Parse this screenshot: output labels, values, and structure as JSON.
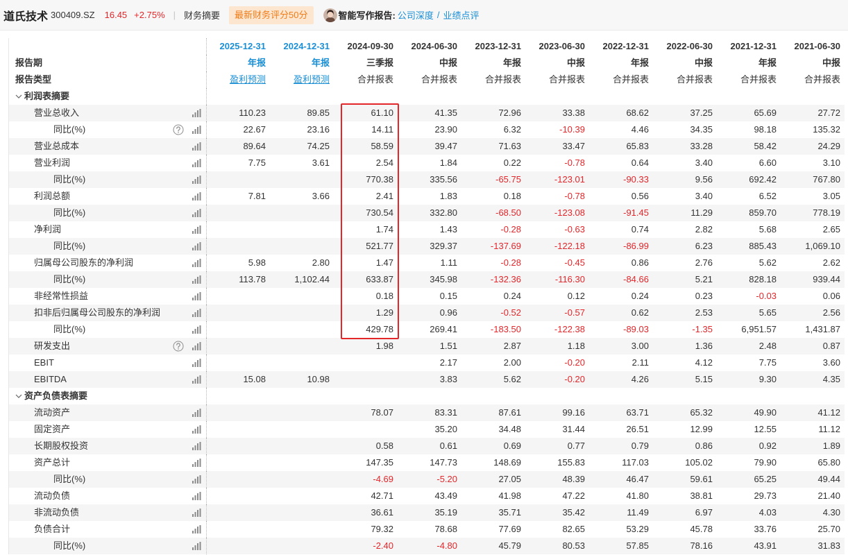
{
  "header": {
    "company": "道氏技术",
    "code": "300409.SZ",
    "price": "16.45",
    "change": "+2.75%",
    "divider": "|",
    "tab": "财务摘要",
    "score_badge": "最新财务评分50分",
    "report_label": "智能写作报告:",
    "report_links": [
      "公司深度",
      "业绩点评"
    ],
    "link_separator": "/"
  },
  "header_labels": {
    "period": "报告期",
    "type": "报告类型"
  },
  "columns": [
    {
      "date": "2025-12-31",
      "period": "年报",
      "type": "盈利预测",
      "forecast": true
    },
    {
      "date": "2024-12-31",
      "period": "年报",
      "type": "盈利预测",
      "forecast": true
    },
    {
      "date": "2024-09-30",
      "period": "三季报",
      "type": "合并报表",
      "forecast": false
    },
    {
      "date": "2024-06-30",
      "period": "中报",
      "type": "合并报表",
      "forecast": false
    },
    {
      "date": "2023-12-31",
      "period": "年报",
      "type": "合并报表",
      "forecast": false
    },
    {
      "date": "2023-06-30",
      "period": "中报",
      "type": "合并报表",
      "forecast": false
    },
    {
      "date": "2022-12-31",
      "period": "年报",
      "type": "合并报表",
      "forecast": false
    },
    {
      "date": "2022-06-30",
      "period": "中报",
      "type": "合并报表",
      "forecast": false
    },
    {
      "date": "2021-12-31",
      "period": "年报",
      "type": "合并报表",
      "forecast": false
    },
    {
      "date": "2021-06-30",
      "period": "中报",
      "type": "合并报表",
      "forecast": false
    }
  ],
  "sections": [
    {
      "title": "利润表摘要",
      "rows": [
        {
          "label": "营业总收入",
          "sub": false,
          "help": false,
          "values": [
            "110.23",
            "89.85",
            "61.10",
            "41.35",
            "72.96",
            "33.38",
            "68.62",
            "37.25",
            "65.69",
            "27.72"
          ]
        },
        {
          "label": "同比(%)",
          "sub": true,
          "help": true,
          "values": [
            "22.67",
            "23.16",
            "14.11",
            "23.90",
            "6.32",
            "-10.39",
            "4.46",
            "34.35",
            "98.18",
            "135.32"
          ]
        },
        {
          "label": "营业总成本",
          "sub": false,
          "help": false,
          "values": [
            "89.64",
            "74.25",
            "58.59",
            "39.47",
            "71.63",
            "33.47",
            "65.83",
            "33.28",
            "58.42",
            "24.29"
          ]
        },
        {
          "label": "营业利润",
          "sub": false,
          "help": false,
          "values": [
            "7.75",
            "3.61",
            "2.54",
            "1.84",
            "0.22",
            "-0.78",
            "0.64",
            "3.40",
            "6.60",
            "3.10"
          ]
        },
        {
          "label": "同比(%)",
          "sub": true,
          "help": false,
          "values": [
            "",
            "",
            "770.38",
            "335.56",
            "-65.75",
            "-123.01",
            "-90.33",
            "9.56",
            "692.42",
            "767.80"
          ]
        },
        {
          "label": "利润总额",
          "sub": false,
          "help": false,
          "values": [
            "7.81",
            "3.66",
            "2.41",
            "1.83",
            "0.18",
            "-0.78",
            "0.56",
            "3.40",
            "6.52",
            "3.05"
          ]
        },
        {
          "label": "同比(%)",
          "sub": true,
          "help": false,
          "values": [
            "",
            "",
            "730.54",
            "332.80",
            "-68.50",
            "-123.08",
            "-91.45",
            "11.29",
            "859.70",
            "778.19"
          ]
        },
        {
          "label": "净利润",
          "sub": false,
          "help": false,
          "values": [
            "",
            "",
            "1.74",
            "1.43",
            "-0.28",
            "-0.63",
            "0.74",
            "2.82",
            "5.68",
            "2.65"
          ]
        },
        {
          "label": "同比(%)",
          "sub": true,
          "help": false,
          "values": [
            "",
            "",
            "521.77",
            "329.37",
            "-137.69",
            "-122.18",
            "-86.99",
            "6.23",
            "885.43",
            "1,069.10"
          ]
        },
        {
          "label": "归属母公司股东的净利润",
          "sub": false,
          "help": false,
          "values": [
            "5.98",
            "2.80",
            "1.47",
            "1.11",
            "-0.28",
            "-0.45",
            "0.86",
            "2.76",
            "5.62",
            "2.62"
          ]
        },
        {
          "label": "同比(%)",
          "sub": true,
          "help": false,
          "values": [
            "113.78",
            "1,102.44",
            "633.87",
            "345.98",
            "-132.36",
            "-116.30",
            "-84.66",
            "5.21",
            "828.18",
            "939.44"
          ]
        },
        {
          "label": "非经常性损益",
          "sub": false,
          "help": false,
          "values": [
            "",
            "",
            "0.18",
            "0.15",
            "0.24",
            "0.12",
            "0.24",
            "0.23",
            "-0.03",
            "0.06"
          ]
        },
        {
          "label": "扣非后归属母公司股东的净利润",
          "sub": false,
          "help": false,
          "values": [
            "",
            "",
            "1.29",
            "0.96",
            "-0.52",
            "-0.57",
            "0.62",
            "2.53",
            "5.65",
            "2.56"
          ]
        },
        {
          "label": "同比(%)",
          "sub": true,
          "help": false,
          "values": [
            "",
            "",
            "429.78",
            "269.41",
            "-183.50",
            "-122.38",
            "-89.03",
            "-1.35",
            "6,951.57",
            "1,431.87"
          ]
        },
        {
          "label": "研发支出",
          "sub": false,
          "help": true,
          "values": [
            "",
            "",
            "1.98",
            "1.51",
            "2.87",
            "1.18",
            "3.00",
            "1.36",
            "2.48",
            "0.87"
          ]
        },
        {
          "label": "EBIT",
          "sub": false,
          "help": false,
          "values": [
            "",
            "",
            "",
            "2.17",
            "2.00",
            "-0.20",
            "2.11",
            "4.12",
            "7.75",
            "3.60"
          ]
        },
        {
          "label": "EBITDA",
          "sub": false,
          "help": false,
          "values": [
            "15.08",
            "10.98",
            "",
            "3.83",
            "5.62",
            "-0.20",
            "4.26",
            "5.15",
            "9.30",
            "4.35"
          ]
        }
      ]
    },
    {
      "title": "资产负债表摘要",
      "rows": [
        {
          "label": "流动资产",
          "sub": false,
          "help": false,
          "values": [
            "",
            "",
            "78.07",
            "83.31",
            "87.61",
            "99.16",
            "63.71",
            "65.32",
            "49.90",
            "41.12"
          ]
        },
        {
          "label": "固定资产",
          "sub": false,
          "help": false,
          "values": [
            "",
            "",
            "",
            "35.20",
            "34.48",
            "31.44",
            "26.51",
            "12.99",
            "12.55",
            "11.12"
          ]
        },
        {
          "label": "长期股权投资",
          "sub": false,
          "help": false,
          "values": [
            "",
            "",
            "0.58",
            "0.61",
            "0.69",
            "0.77",
            "0.79",
            "0.86",
            "0.92",
            "1.89"
          ]
        },
        {
          "label": "资产总计",
          "sub": false,
          "help": false,
          "values": [
            "",
            "",
            "147.35",
            "147.73",
            "148.69",
            "155.83",
            "117.03",
            "105.02",
            "79.90",
            "65.80"
          ]
        },
        {
          "label": "同比(%)",
          "sub": true,
          "help": false,
          "values": [
            "",
            "",
            "-4.69",
            "-5.20",
            "27.05",
            "48.39",
            "46.47",
            "59.61",
            "65.25",
            "49.44"
          ]
        },
        {
          "label": "流动负债",
          "sub": false,
          "help": false,
          "values": [
            "",
            "",
            "42.71",
            "43.49",
            "41.98",
            "47.22",
            "41.80",
            "38.81",
            "29.73",
            "21.40"
          ]
        },
        {
          "label": "非流动负债",
          "sub": false,
          "help": false,
          "values": [
            "",
            "",
            "36.61",
            "35.19",
            "35.71",
            "35.42",
            "11.49",
            "6.97",
            "4.03",
            "4.30"
          ]
        },
        {
          "label": "负债合计",
          "sub": false,
          "help": false,
          "values": [
            "",
            "",
            "79.32",
            "78.68",
            "77.69",
            "82.65",
            "53.29",
            "45.78",
            "33.76",
            "25.70"
          ]
        },
        {
          "label": "同比(%)",
          "sub": true,
          "help": false,
          "values": [
            "",
            "",
            "-2.40",
            "-4.80",
            "45.79",
            "80.53",
            "57.85",
            "78.16",
            "43.91",
            "31.83"
          ]
        }
      ]
    }
  ],
  "highlight": {
    "section": 0,
    "column": 2,
    "row_from": 0,
    "row_to": 13
  },
  "icons": {
    "section_toggle": "chevron-down-icon",
    "help": "help-icon",
    "chart": "bar-chart-icon",
    "author": "avatar"
  },
  "colors": {
    "price": "#e3262a",
    "negative": "#e3262a",
    "forecast": "#1a8fd6",
    "badge_text": "#f07d1a",
    "badge_bg": "#fde6d0",
    "highlight_box": "#e3262a"
  }
}
